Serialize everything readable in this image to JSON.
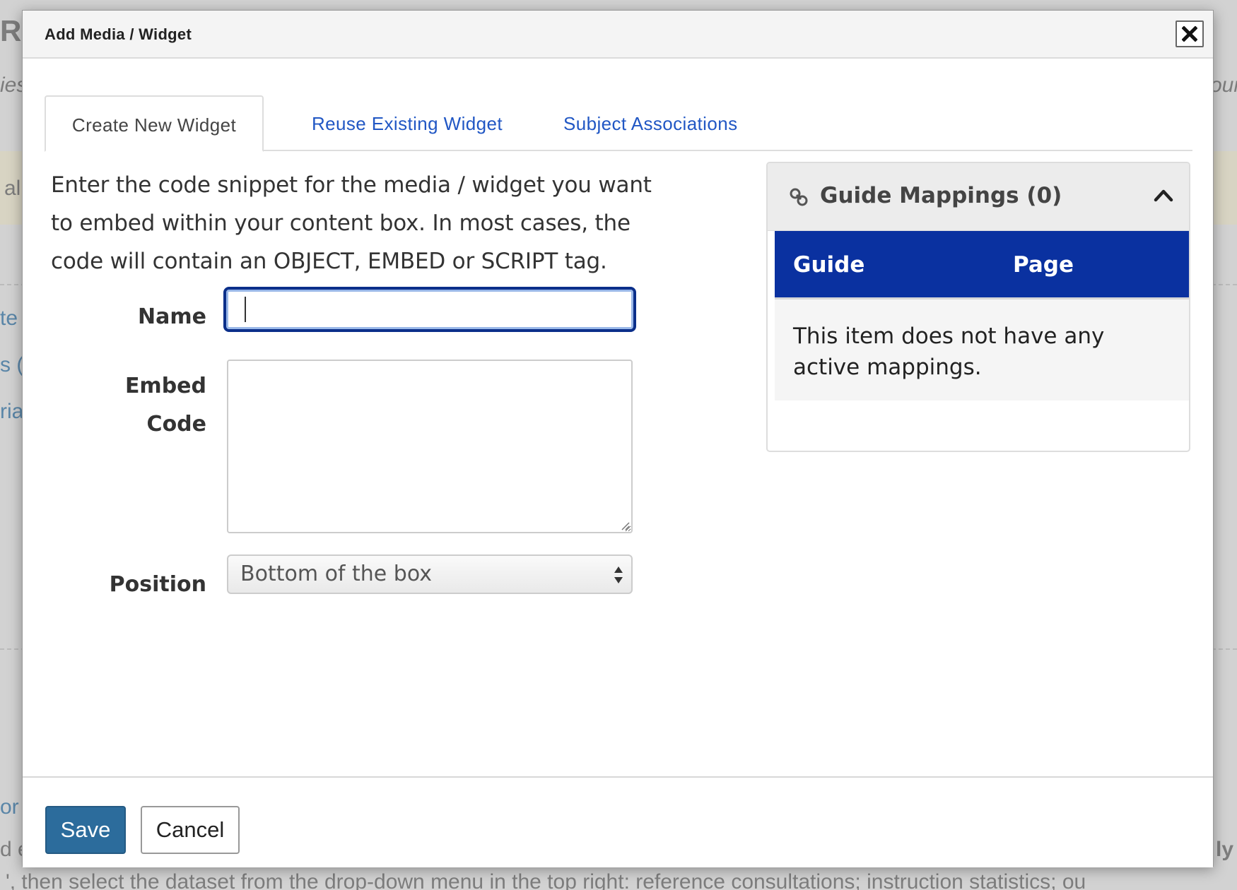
{
  "background": {
    "fragments": [
      "R",
      "ies",
      "al",
      "te",
      "s (",
      "ria",
      "or",
      "d e",
      "our",
      "ly"
    ],
    "bottom_text": "', then select the dataset from the drop-down menu in the top right: reference consultations; instruction statistics; ou"
  },
  "modal": {
    "title": "Add Media / Widget",
    "close_icon": "close-icon"
  },
  "tabs": [
    {
      "label": "Create New Widget",
      "active": true
    },
    {
      "label": "Reuse Existing Widget",
      "active": false
    },
    {
      "label": "Subject Associations",
      "active": false
    }
  ],
  "form": {
    "intro": "Enter the code snippet for the media / widget you want to embed within your content box. In most cases, the code will contain an OBJECT, EMBED or SCRIPT tag.",
    "name_label": "Name",
    "name_value": "",
    "embed_label_line1": "Embed",
    "embed_label_line2": "Code",
    "embed_value": "",
    "position_label": "Position",
    "position_selected": "Bottom of the box"
  },
  "guide_mappings": {
    "title": "Guide Mappings (0)",
    "icon": "link-icon",
    "columns": [
      "Guide",
      "Page"
    ],
    "empty_message": "This item does not have any active mappings."
  },
  "footer": {
    "save_label": "Save",
    "cancel_label": "Cancel"
  },
  "colors": {
    "tab_link": "#2157c4",
    "table_header": "#0a31a0",
    "save_button": "#2c6c9c",
    "focus_border": "#0b2f8a"
  }
}
